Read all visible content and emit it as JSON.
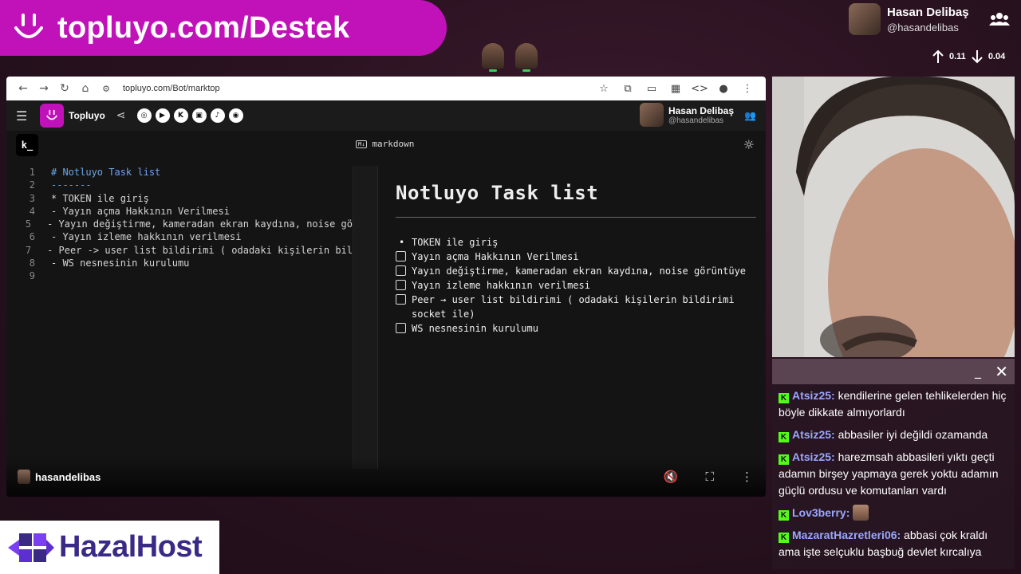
{
  "banner": {
    "title": "topluyo.com/Destek"
  },
  "streamer": {
    "name": "Hasan Delibaş",
    "handle": "@hasandelibas"
  },
  "stats": {
    "up": "0.11",
    "down": "0.04"
  },
  "browser": {
    "url": "topluyo.com/Bot/marktop"
  },
  "app": {
    "name": "Topluyo",
    "user_name": "Hasan Delibaş",
    "user_handle": "@hasandelibas",
    "editor_mode": "markdown",
    "k_logo": "k_"
  },
  "editor": {
    "lines": [
      {
        "n": "1",
        "text": "# Notluyo Task list"
      },
      {
        "n": "2",
        "text": "-------"
      },
      {
        "n": "3",
        "text": "* TOKEN ile giriş"
      },
      {
        "n": "4",
        "text": "- Yayın açma Hakkının Verilmesi"
      },
      {
        "n": "5",
        "text": "- Yayın değiştirme, kameradan ekran kaydına, noise gö"
      },
      {
        "n": "6",
        "text": "- Yayın izleme hakkının verilmesi"
      },
      {
        "n": "7",
        "text": "- Peer -> user list bildirimi ( odadaki kişilerin bil"
      },
      {
        "n": "8",
        "text": "- WS nesnesinin kurulumu"
      },
      {
        "n": "9",
        "text": ""
      }
    ]
  },
  "preview": {
    "title": "Notluyo Task list",
    "bullet_item": "TOKEN ile giriş",
    "tasks": [
      "Yayın açma Hakkının Verilmesi",
      "Yayın değiştirme, kameradan ekran kaydına, noise görüntüye",
      "Yayın izleme hakkının verilmesi",
      "Peer → user list bildirimi ( odadaki kişilerin bildirimi socket ile)",
      "WS nesnesinin kurulumu"
    ]
  },
  "player": {
    "channel": "hasandelibas"
  },
  "chat": {
    "messages": [
      {
        "user": "Atsiz25:",
        "text": " kendilerine gelen tehlikelerden hiç böyle dikkate almıyorlardı"
      },
      {
        "user": "Atsiz25:",
        "text": " abbasiler iyi değildi ozamanda"
      },
      {
        "user": "Atsiz25:",
        "text": " harezmsah abbasileri yıktı geçti adamın birşey yapmaya gerek yoktu adamın güçlü ordusu ve komutanları vardı"
      },
      {
        "user": "Lov3berry:",
        "text": ""
      },
      {
        "user": "MazaratHazretleri06:",
        "text": " abbasi çok kraldı ama işte selçuklu başbuğ devlet kırcalıya"
      }
    ]
  },
  "sponsor": {
    "name": "HazalHost"
  },
  "colors": {
    "brand": "#c012b8",
    "kick": "#53fc18",
    "chat_user": "#9aa6ff"
  }
}
